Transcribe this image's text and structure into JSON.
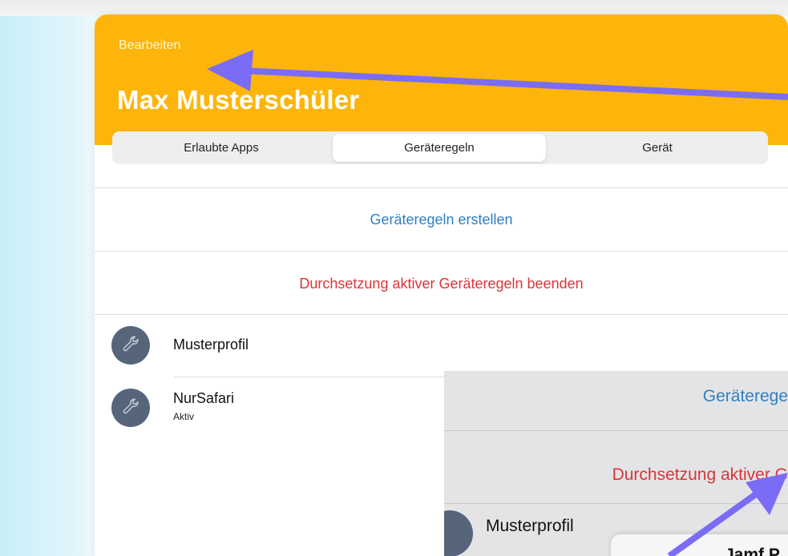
{
  "header": {
    "edit_label": "Bearbeiten",
    "title": "Max Musterschüler",
    "accent_color": "#fdb50b"
  },
  "tabs": [
    {
      "label": "Erlaubte Apps",
      "selected": false
    },
    {
      "label": "Geräteregeln",
      "selected": true
    },
    {
      "label": "Gerät",
      "selected": false
    }
  ],
  "actions": {
    "create": "Geräteregeln erstellen",
    "end_enforcement": "Durchsetzung aktiver Geräteregeln beenden"
  },
  "profiles": [
    {
      "name": "Musterprofil",
      "status": "",
      "icon": "wrench-icon"
    },
    {
      "name": "NurSafari",
      "status": "Aktiv",
      "icon": "wrench-icon"
    }
  ],
  "overlay": {
    "create": "Geräterege",
    "end_enforcement": "Durchsetzung aktiver G",
    "profile_name": "Musterprofil",
    "sheet_title": "Jamf P"
  },
  "annotation_color": "#7b6cf6"
}
